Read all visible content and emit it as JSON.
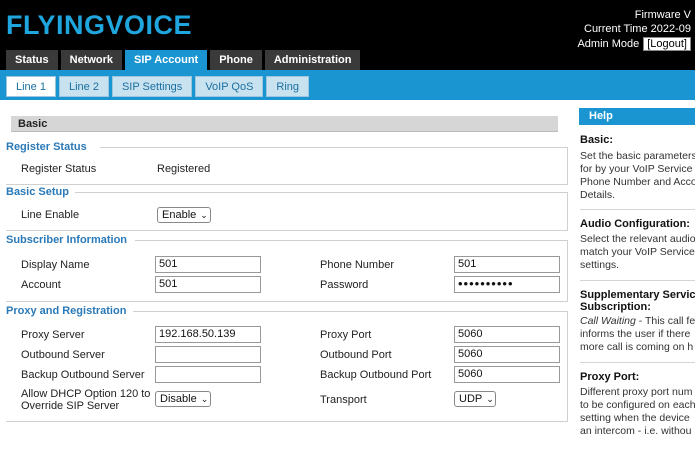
{
  "header": {
    "logo": "FLYINGVOICE",
    "firmware": "Firmware V",
    "current_time": "Current Time 2022-09",
    "admin_mode": "Admin Mode",
    "logout": "[Logout]"
  },
  "main_tabs": [
    "Status",
    "Network",
    "SIP Account",
    "Phone",
    "Administration"
  ],
  "sub_tabs": [
    "Line 1",
    "Line 2",
    "SIP Settings",
    "VoIP QoS",
    "Ring"
  ],
  "basic_title": "Basic",
  "register_status": {
    "title": "Register Status",
    "label": "Register Status",
    "value": "Registered"
  },
  "basic_setup": {
    "title": "Basic Setup",
    "line_enable_label": "Line Enable",
    "line_enable_value": "Enable"
  },
  "subscriber": {
    "title": "Subscriber Information",
    "display_name_label": "Display Name",
    "display_name_value": "501",
    "phone_number_label": "Phone Number",
    "phone_number_value": "501",
    "account_label": "Account",
    "account_value": "501",
    "password_label": "Password",
    "password_value": "••••••••••"
  },
  "proxy": {
    "title": "Proxy and Registration",
    "proxy_server_label": "Proxy Server",
    "proxy_server_value": "192.168.50.139",
    "proxy_port_label": "Proxy Port",
    "proxy_port_value": "5060",
    "outbound_server_label": "Outbound Server",
    "outbound_server_value": "",
    "outbound_port_label": "Outbound Port",
    "outbound_port_value": "5060",
    "backup_outbound_server_label": "Backup Outbound Server",
    "backup_outbound_server_value": "",
    "backup_outbound_port_label": "Backup Outbound Port",
    "backup_outbound_port_value": "5060",
    "dhcp_label_1": "Allow DHCP Option 120 to",
    "dhcp_label_2": "Override SIP Server",
    "dhcp_value": "Disable",
    "transport_label": "Transport",
    "transport_value": "UDP"
  },
  "help": {
    "title": "Help",
    "basic_h": "Basic:",
    "basic_p1": "Set the basic parameters",
    "basic_p2": "for by your VoIP Service",
    "basic_p3": "Phone Number and Acco",
    "basic_p4": "Details.",
    "audio_h": "Audio Configuration:",
    "audio_p1": "Select the relevant audio",
    "audio_p2": "match your VoIP Service",
    "audio_p3": "settings.",
    "supp_h1": "Supplementary Servic",
    "supp_h2": "Subscription:",
    "supp_p1_em": "Call Waiting",
    "supp_p1_rest": " - This call fe",
    "supp_p2": "informs the user if there",
    "supp_p3": "more call is coming on h",
    "proxy_h": "Proxy Port:",
    "proxy_p1": "Different proxy port num",
    "proxy_p2": "to be configured on each",
    "proxy_p3": "setting when the device",
    "proxy_p4": "an intercom - i.e. withou"
  }
}
